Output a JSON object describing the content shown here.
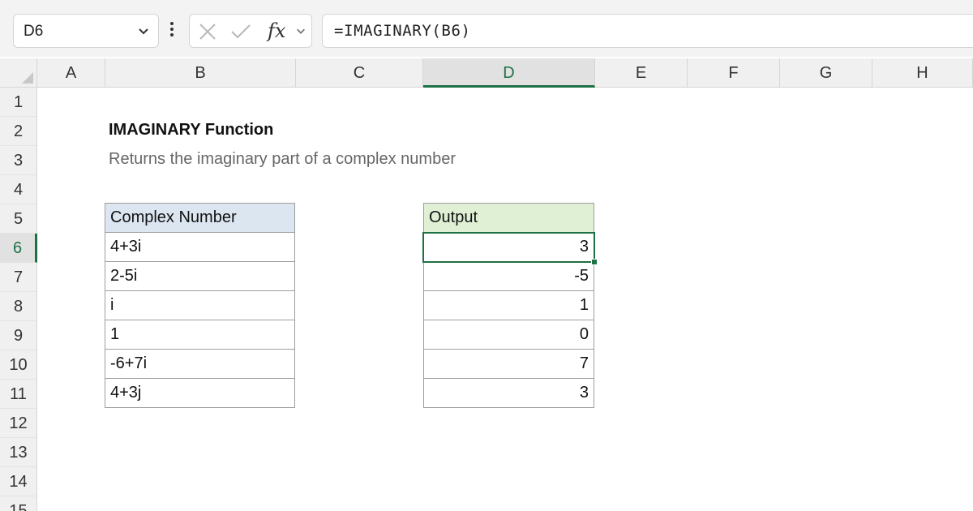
{
  "formula_bar": {
    "name_box": "D6",
    "fx_label": "fx",
    "formula": "=IMAGINARY(B6)"
  },
  "columns": [
    "A",
    "B",
    "C",
    "D",
    "E",
    "F",
    "G",
    "H"
  ],
  "active_column": "D",
  "rows": [
    "1",
    "2",
    "3",
    "4",
    "5",
    "6",
    "7",
    "8",
    "9",
    "10",
    "11",
    "12",
    "13",
    "14",
    "15"
  ],
  "active_row": "6",
  "sheet": {
    "title": "IMAGINARY Function",
    "subtitle": "Returns the imaginary part of a complex number",
    "input_table": {
      "header": "Complex Number",
      "values": [
        "4+3i",
        "2-5i",
        "i",
        "1",
        "-6+7i",
        "4+3j"
      ]
    },
    "output_table": {
      "header": "Output",
      "values": [
        "3",
        "-5",
        "1",
        "0",
        "7",
        "3"
      ]
    }
  },
  "colors": {
    "accent_green": "#1e7145",
    "input_header_fill": "#dce6f1",
    "output_header_fill": "#dff0d5"
  }
}
